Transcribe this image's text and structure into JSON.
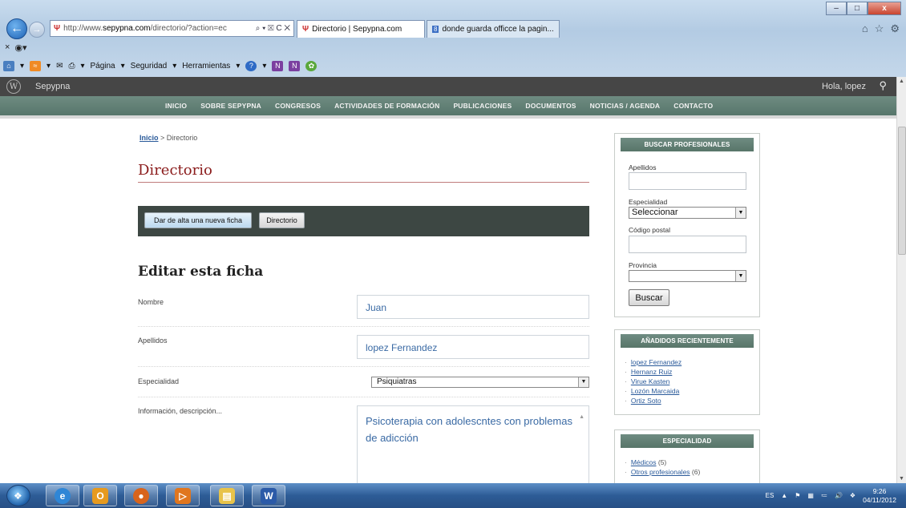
{
  "browser": {
    "address_prefix": "http://www.",
    "address_domain": "sepypna.com",
    "address_suffix": "/directorio/?action=ec",
    "address_tools": "⌕ ▾ ☒ C ✕",
    "tabs": [
      {
        "label": "Directorio | Sepypna.com",
        "active": true
      },
      {
        "label": "donde guarda officce la pagin...",
        "active": false
      }
    ],
    "command_bar": {
      "page": "Página",
      "safety": "Seguridad",
      "tools": "Herramientas"
    },
    "window_buttons": {
      "minimize": "–",
      "maximize": "□",
      "close": "x"
    }
  },
  "wp_admin_bar": {
    "site_name": "Sepypna",
    "greeting": "Hola, lopez"
  },
  "site_nav": {
    "items": [
      "INICIO",
      "SOBRE SEPYPNA",
      "CONGRESOS",
      "ACTIVIDADES DE FORMACIÓN",
      "PUBLICACIONES",
      "DOCUMENTOS",
      "NOTICIAS / AGENDA",
      "CONTACTO"
    ]
  },
  "main": {
    "breadcrumb": {
      "home": "Inicio",
      "separator": " > ",
      "current": "Directorio"
    },
    "title": "Directorio",
    "buttons": {
      "new_entry": "Dar de alta una nueva ficha",
      "directory": "Directorio"
    },
    "section_title": "Editar esta ficha",
    "form": {
      "nombre_label": "Nombre",
      "nombre_value": "Juan",
      "apellidos_label": "Apellidos",
      "apellidos_value": "lopez Fernandez",
      "especialidad_label": "Especialidad",
      "especialidad_value": "Psiquiatras",
      "info_label": "Información, descripción...",
      "info_value": "Psicoterapia con adolescntes con problemas de adicción"
    }
  },
  "sidebar": {
    "search_widget": {
      "title": "BUSCAR PROFESIONALES",
      "apellidos_label": "Apellidos",
      "especialidad_label": "Especialidad",
      "especialidad_value": "Seleccionar",
      "cp_label": "Código postal",
      "provincia_label": "Provincia",
      "provincia_value": "",
      "button": "Buscar"
    },
    "recent_widget": {
      "title": "AÑADIDOS RECIENTEMENTE",
      "items": [
        "lopez Fernandez",
        "Hernanz Ruiz",
        "Virue Kasten",
        "Lozón Marcaida",
        "Ortiz Soto"
      ]
    },
    "specialty_widget": {
      "title": "ESPECIALIDAD",
      "items": [
        {
          "label": "Médicos",
          "count": "(5)"
        },
        {
          "label": "Otros profesionales",
          "count": "(6)"
        }
      ]
    }
  },
  "taskbar": {
    "language": "ES",
    "time": "9:26",
    "date": "04/11/2012"
  },
  "colors": {
    "nav_green": "#5f7d72",
    "title_red": "#8b1c1c",
    "link_blue": "#2a5a9a",
    "action_bar": "#3d4743"
  }
}
